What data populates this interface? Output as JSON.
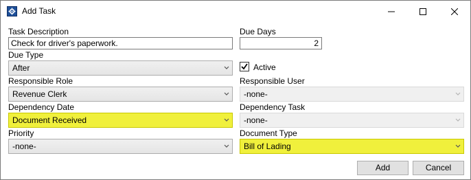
{
  "window": {
    "title": "Add Task"
  },
  "fields": {
    "task_description": {
      "label": "Task Description",
      "value": "Check for driver's paperwork."
    },
    "due_days": {
      "label": "Due Days",
      "value": "2"
    },
    "due_type": {
      "label": "Due Type",
      "value": "After"
    },
    "active": {
      "label": "Active",
      "checked": true
    },
    "responsible_role": {
      "label": "Responsible Role",
      "value": "Revenue Clerk"
    },
    "responsible_user": {
      "label": "Responsible User",
      "value": "-none-"
    },
    "dependency_date": {
      "label": "Dependency Date",
      "value": "Document Received"
    },
    "dependency_task": {
      "label": "Dependency Task",
      "value": "-none-"
    },
    "priority": {
      "label": "Priority",
      "value": "-none-"
    },
    "document_type": {
      "label": "Document Type",
      "value": "Bill of Lading"
    }
  },
  "buttons": {
    "add": "Add",
    "cancel": "Cancel"
  },
  "colors": {
    "highlight": "#f0f03c",
    "disabled_bg": "#f0f0f0",
    "button_bg": "#e1e1e1"
  }
}
